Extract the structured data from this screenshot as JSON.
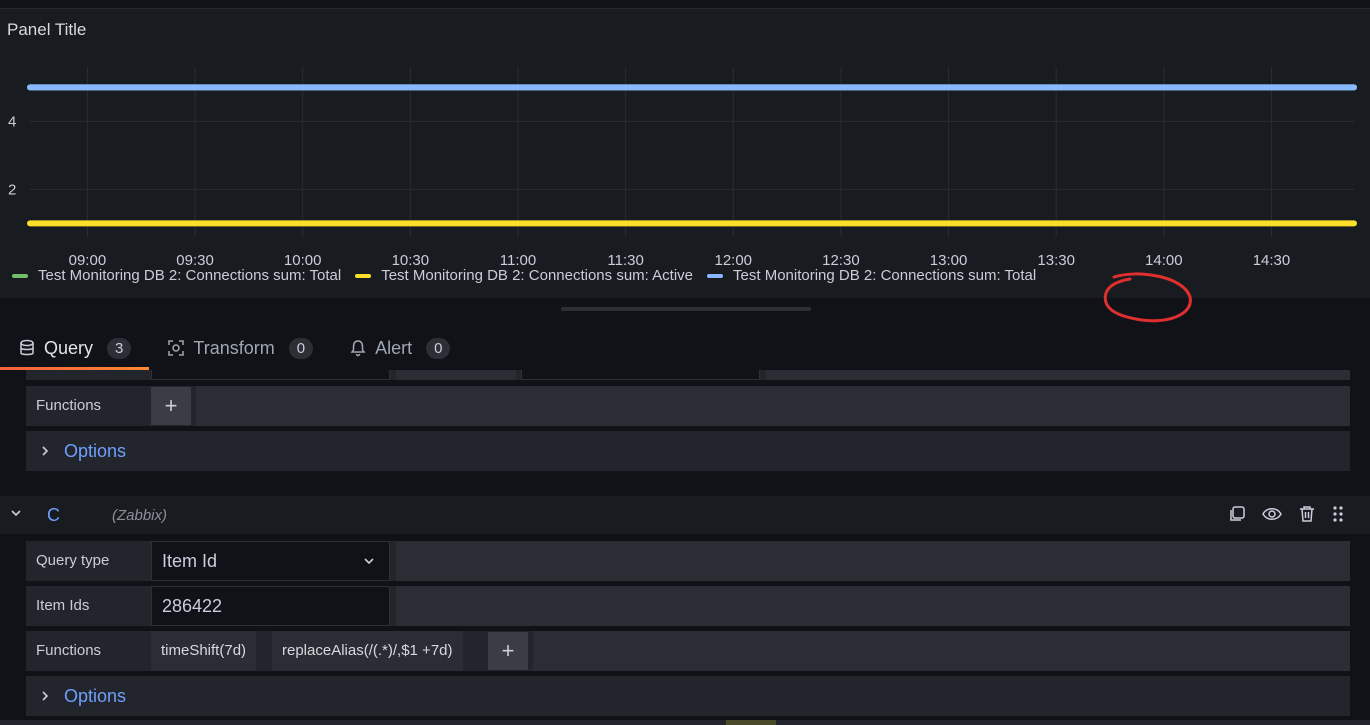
{
  "panel": {
    "title": "Panel Title"
  },
  "chart_data": {
    "type": "line",
    "title": "Panel Title",
    "x": [
      "08:44",
      "14:53"
    ],
    "x_ticks": [
      "09:00",
      "09:30",
      "10:00",
      "10:30",
      "11:00",
      "11:30",
      "12:00",
      "12:30",
      "13:00",
      "13:30",
      "14:00",
      "14:30"
    ],
    "y_ticks": [
      2,
      4
    ],
    "ylim": [
      0.6,
      5.6
    ],
    "grid": true,
    "legend_position": "bottom-left",
    "series": [
      {
        "name": "Test Monitoring DB 2: Connections sum: Total",
        "color": "#73bf69",
        "values": [
          5,
          5
        ]
      },
      {
        "name": "Test Monitoring DB 2: Connections sum: Active",
        "color": "#fade2a",
        "values": [
          1,
          1
        ]
      },
      {
        "name": "Test Monitoring DB 2: Connections sum: Total",
        "color": "#8ab8ff",
        "values": [
          5,
          5
        ]
      }
    ]
  },
  "tabs": [
    {
      "label": "Query",
      "count": "3",
      "icon": "database-icon"
    },
    {
      "label": "Transform",
      "count": "0",
      "icon": "transform-icon"
    },
    {
      "label": "Alert",
      "count": "0",
      "icon": "bell-icon"
    }
  ],
  "query_b": {
    "functions_label": "Functions",
    "options_label": "Options"
  },
  "query_c": {
    "ref_id": "C",
    "datasource": "(Zabbix)",
    "query_type_label": "Query type",
    "query_type_value": "Item Id",
    "item_ids_label": "Item Ids",
    "item_ids_value": "286422",
    "functions_label": "Functions",
    "functions": [
      "timeShift(7d)",
      "replaceAlias(/(.*)/,$1 +7d)"
    ],
    "options_label": "Options"
  },
  "colors": {
    "accent": "#6e9fff",
    "tab_underline": "#f55f3e",
    "annotation": "#e02f2f"
  }
}
